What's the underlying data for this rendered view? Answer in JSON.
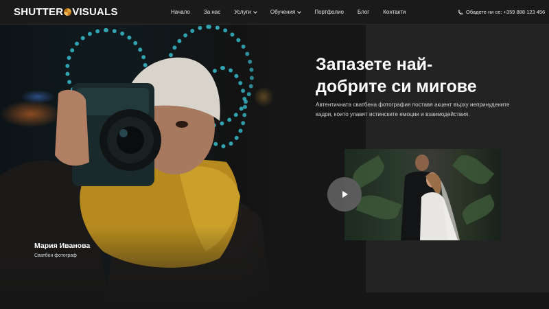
{
  "header": {
    "logo_left": "SHUTTER",
    "logo_right": "VISUALS",
    "nav": [
      {
        "label": "Начало",
        "dropdown": false
      },
      {
        "label": "За нас",
        "dropdown": false
      },
      {
        "label": "Услуги",
        "dropdown": true
      },
      {
        "label": "Обучения",
        "dropdown": true
      },
      {
        "label": "Портфолио",
        "dropdown": false
      },
      {
        "label": "Блог",
        "dropdown": false
      },
      {
        "label": "Контакти",
        "dropdown": false
      }
    ],
    "phone": "Обадете ни се: +359 888 123 456"
  },
  "hero": {
    "photographer_name": "Мария Иванова",
    "photographer_role": "Сватбен фотограф",
    "headline_line1": "Запазете най-",
    "headline_line2": "добрите си мигове",
    "description": "Автентичната сватбена фотография поставя акцент върху непринудените кадри, които улавят истинските емоции и взаимодействия."
  },
  "colors": {
    "background": "#161616",
    "header": "#1a1a1a",
    "panel": "#232323",
    "accent_logo": "#e3a53a",
    "bokeh": "#3cd2e6"
  },
  "icons": {
    "phone": "phone-icon",
    "play": "play-icon",
    "chevron": "chevron-down-icon"
  }
}
